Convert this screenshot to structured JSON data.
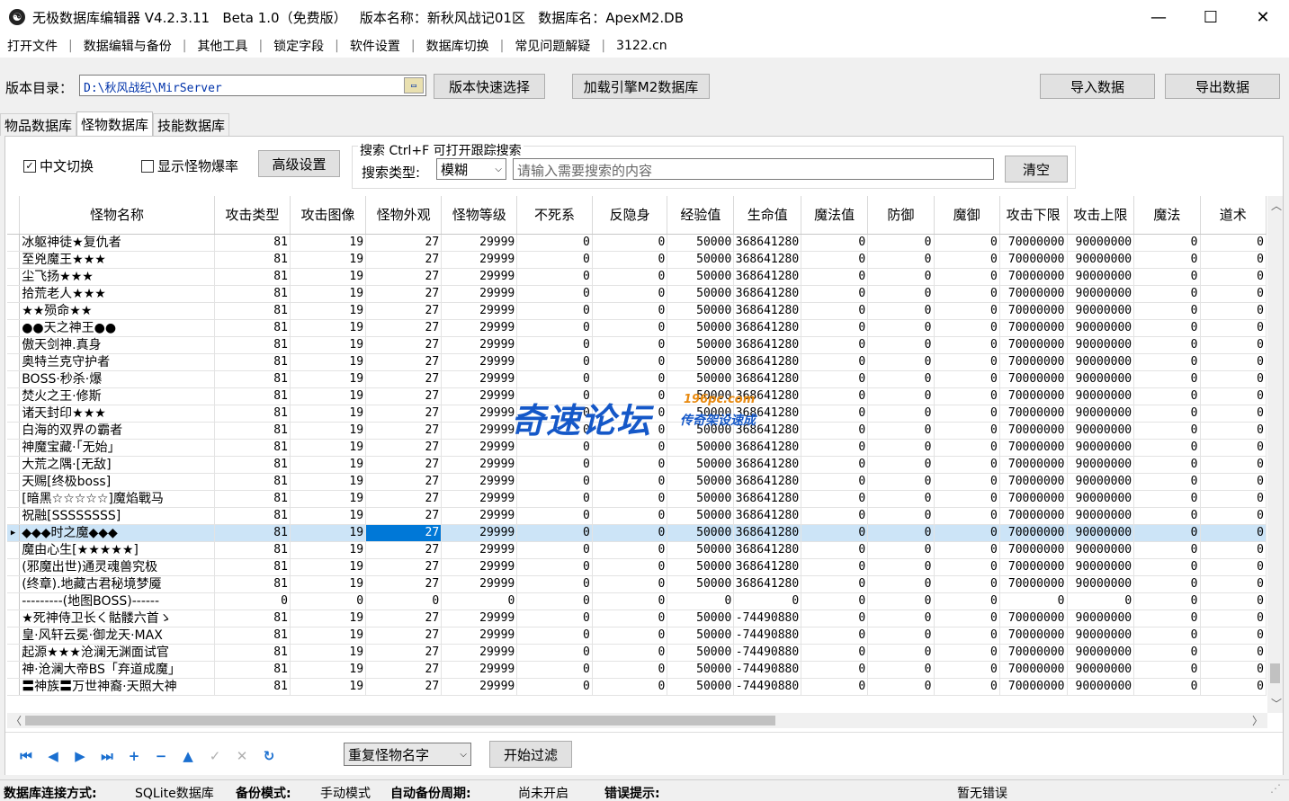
{
  "window": {
    "title": "无极数据库编辑器 V4.2.3.11   Beta 1.0（免费版）   版本名称：新秋风战记01区   数据库名：ApexM2.DB",
    "minimize": "—",
    "maximize": "☐",
    "close": "✕"
  },
  "menu": [
    "打开文件",
    "数据编辑与备份",
    "其他工具",
    "锁定字段",
    "软件设置",
    "数据库切换",
    "常见问题解疑",
    "3122.cn"
  ],
  "menu_sep": "|",
  "toolbar": {
    "dir_label": "版本目录：",
    "dir_value": "D:\\秋风战纪\\MirServer",
    "quick_select": "版本快速选择",
    "load_db": "加载引擎M2数据库",
    "import": "导入数据",
    "export": "导出数据"
  },
  "tabs": [
    "物品数据库",
    "怪物数据库",
    "技能数据库"
  ],
  "filter": {
    "chinese_switch": "中文切换",
    "show_drop": "显示怪物爆率",
    "advanced": "高级设置",
    "search_hint": "搜索  Ctrl+F 可打开跟踪搜索",
    "search_type_label": "搜索类型:",
    "search_type_value": "模糊",
    "search_placeholder": "请输入需要搜索的内容",
    "clear": "清空"
  },
  "grid": {
    "columns": [
      "怪物名称",
      "攻击类型",
      "攻击图像",
      "怪物外观",
      "怪物等级",
      "不死系",
      "反隐身",
      "经验值",
      "生命值",
      "魔法值",
      "防御",
      "魔御",
      "攻击下限",
      "攻击上限",
      "魔法",
      "道术"
    ],
    "selected_row": 17,
    "selected_col": 3,
    "rows": [
      [
        "冰躯神徒★复仇者",
        "81",
        "19",
        "27",
        "29999",
        "0",
        "0",
        "50000",
        "368641280",
        "0",
        "0",
        "0",
        "70000000",
        "90000000",
        "0",
        "0"
      ],
      [
        "至兇魔王★★★",
        "81",
        "19",
        "27",
        "29999",
        "0",
        "0",
        "50000",
        "368641280",
        "0",
        "0",
        "0",
        "70000000",
        "90000000",
        "0",
        "0"
      ],
      [
        "尘飞扬★★★",
        "81",
        "19",
        "27",
        "29999",
        "0",
        "0",
        "50000",
        "368641280",
        "0",
        "0",
        "0",
        "70000000",
        "90000000",
        "0",
        "0"
      ],
      [
        "拾荒老人★★★",
        "81",
        "19",
        "27",
        "29999",
        "0",
        "0",
        "50000",
        "368641280",
        "0",
        "0",
        "0",
        "70000000",
        "90000000",
        "0",
        "0"
      ],
      [
        "★★殒命★★",
        "81",
        "19",
        "27",
        "29999",
        "0",
        "0",
        "50000",
        "368641280",
        "0",
        "0",
        "0",
        "70000000",
        "90000000",
        "0",
        "0"
      ],
      [
        "●●天之神王●●",
        "81",
        "19",
        "27",
        "29999",
        "0",
        "0",
        "50000",
        "368641280",
        "0",
        "0",
        "0",
        "70000000",
        "90000000",
        "0",
        "0"
      ],
      [
        "傲天剑神.真身",
        "81",
        "19",
        "27",
        "29999",
        "0",
        "0",
        "50000",
        "368641280",
        "0",
        "0",
        "0",
        "70000000",
        "90000000",
        "0",
        "0"
      ],
      [
        "奥特兰克守护者",
        "81",
        "19",
        "27",
        "29999",
        "0",
        "0",
        "50000",
        "368641280",
        "0",
        "0",
        "0",
        "70000000",
        "90000000",
        "0",
        "0"
      ],
      [
        "BOSS·秒杀·爆",
        "81",
        "19",
        "27",
        "29999",
        "0",
        "0",
        "50000",
        "368641280",
        "0",
        "0",
        "0",
        "70000000",
        "90000000",
        "0",
        "0"
      ],
      [
        "焚火之王·修斯",
        "81",
        "19",
        "27",
        "29999",
        "0",
        "0",
        "50000",
        "368641280",
        "0",
        "0",
        "0",
        "70000000",
        "90000000",
        "0",
        "0"
      ],
      [
        "诸天封印★★★",
        "81",
        "19",
        "27",
        "29999",
        "0",
        "0",
        "50000",
        "368641280",
        "0",
        "0",
        "0",
        "70000000",
        "90000000",
        "0",
        "0"
      ],
      [
        "白海的双界の霸者",
        "81",
        "19",
        "27",
        "29999",
        "0",
        "0",
        "50000",
        "368641280",
        "0",
        "0",
        "0",
        "70000000",
        "90000000",
        "0",
        "0"
      ],
      [
        "神魔宝藏·「无始」",
        "81",
        "19",
        "27",
        "29999",
        "0",
        "0",
        "50000",
        "368641280",
        "0",
        "0",
        "0",
        "70000000",
        "90000000",
        "0",
        "0"
      ],
      [
        "大荒之隅·[无敌]",
        "81",
        "19",
        "27",
        "29999",
        "0",
        "0",
        "50000",
        "368641280",
        "0",
        "0",
        "0",
        "70000000",
        "90000000",
        "0",
        "0"
      ],
      [
        "天赐[终极boss]",
        "81",
        "19",
        "27",
        "29999",
        "0",
        "0",
        "50000",
        "368641280",
        "0",
        "0",
        "0",
        "70000000",
        "90000000",
        "0",
        "0"
      ],
      [
        "[暗黑☆☆☆☆☆]魔焰戰马",
        "81",
        "19",
        "27",
        "29999",
        "0",
        "0",
        "50000",
        "368641280",
        "0",
        "0",
        "0",
        "70000000",
        "90000000",
        "0",
        "0"
      ],
      [
        "祝融[SSSSSSSS]",
        "81",
        "19",
        "27",
        "29999",
        "0",
        "0",
        "50000",
        "368641280",
        "0",
        "0",
        "0",
        "70000000",
        "90000000",
        "0",
        "0"
      ],
      [
        "◆◆◆时之魔◆◆◆",
        "81",
        "19",
        "27",
        "29999",
        "0",
        "0",
        "50000",
        "368641280",
        "0",
        "0",
        "0",
        "70000000",
        "90000000",
        "0",
        "0"
      ],
      [
        "魔由心生[★★★★★]",
        "81",
        "19",
        "27",
        "29999",
        "0",
        "0",
        "50000",
        "368641280",
        "0",
        "0",
        "0",
        "70000000",
        "90000000",
        "0",
        "0"
      ],
      [
        "(邪魔出世)通灵魂兽究极",
        "81",
        "19",
        "27",
        "29999",
        "0",
        "0",
        "50000",
        "368641280",
        "0",
        "0",
        "0",
        "70000000",
        "90000000",
        "0",
        "0"
      ],
      [
        "(终章).地藏古君秘境梦魇",
        "81",
        "19",
        "27",
        "29999",
        "0",
        "0",
        "50000",
        "368641280",
        "0",
        "0",
        "0",
        "70000000",
        "90000000",
        "0",
        "0"
      ],
      [
        "---------(地图BOSS)------",
        "0",
        "0",
        "0",
        "0",
        "0",
        "0",
        "0",
        "0",
        "0",
        "0",
        "0",
        "0",
        "0",
        "0",
        "0"
      ],
      [
        "★死神侍卫长く骷髅六首ゝ",
        "81",
        "19",
        "27",
        "29999",
        "0",
        "0",
        "50000",
        "-74490880",
        "0",
        "0",
        "0",
        "70000000",
        "90000000",
        "0",
        "0"
      ],
      [
        "皇·风轩云冕·御龙天·MAX",
        "81",
        "19",
        "27",
        "29999",
        "0",
        "0",
        "50000",
        "-74490880",
        "0",
        "0",
        "0",
        "70000000",
        "90000000",
        "0",
        "0"
      ],
      [
        "起源★★★沧澜无渊面试官",
        "81",
        "19",
        "27",
        "29999",
        "0",
        "0",
        "50000",
        "-74490880",
        "0",
        "0",
        "0",
        "70000000",
        "90000000",
        "0",
        "0"
      ],
      [
        "神·沧澜大帝BS「弃道成魔」",
        "81",
        "19",
        "27",
        "29999",
        "0",
        "0",
        "50000",
        "-74490880",
        "0",
        "0",
        "0",
        "70000000",
        "90000000",
        "0",
        "0"
      ],
      [
        "〓神族〓万世神裔·天照大神",
        "81",
        "19",
        "27",
        "29999",
        "0",
        "0",
        "50000",
        "-74490880",
        "0",
        "0",
        "0",
        "70000000",
        "90000000",
        "0",
        "0"
      ]
    ]
  },
  "nav": {
    "icons": [
      "first-icon",
      "prev-icon",
      "next-icon",
      "last-icon",
      "add-icon",
      "remove-icon",
      "up-icon",
      "check-icon",
      "cancel-icon",
      "refresh-icon"
    ],
    "filter_select": "重复怪物名字",
    "filter_button": "开始过滤"
  },
  "status": {
    "conn_label": "数据库连接方式:",
    "conn_value": "SQLite数据库",
    "backup_label": "备份模式:",
    "backup_value": "手动模式",
    "period_label": "自动备份周期:",
    "period_value": "尚未开启",
    "error_label": "错误提示:",
    "error_value": "暂无错误"
  },
  "watermark": {
    "main": "奇速论坛",
    "site": "196pc.com",
    "sub": "传奇架设速成"
  }
}
